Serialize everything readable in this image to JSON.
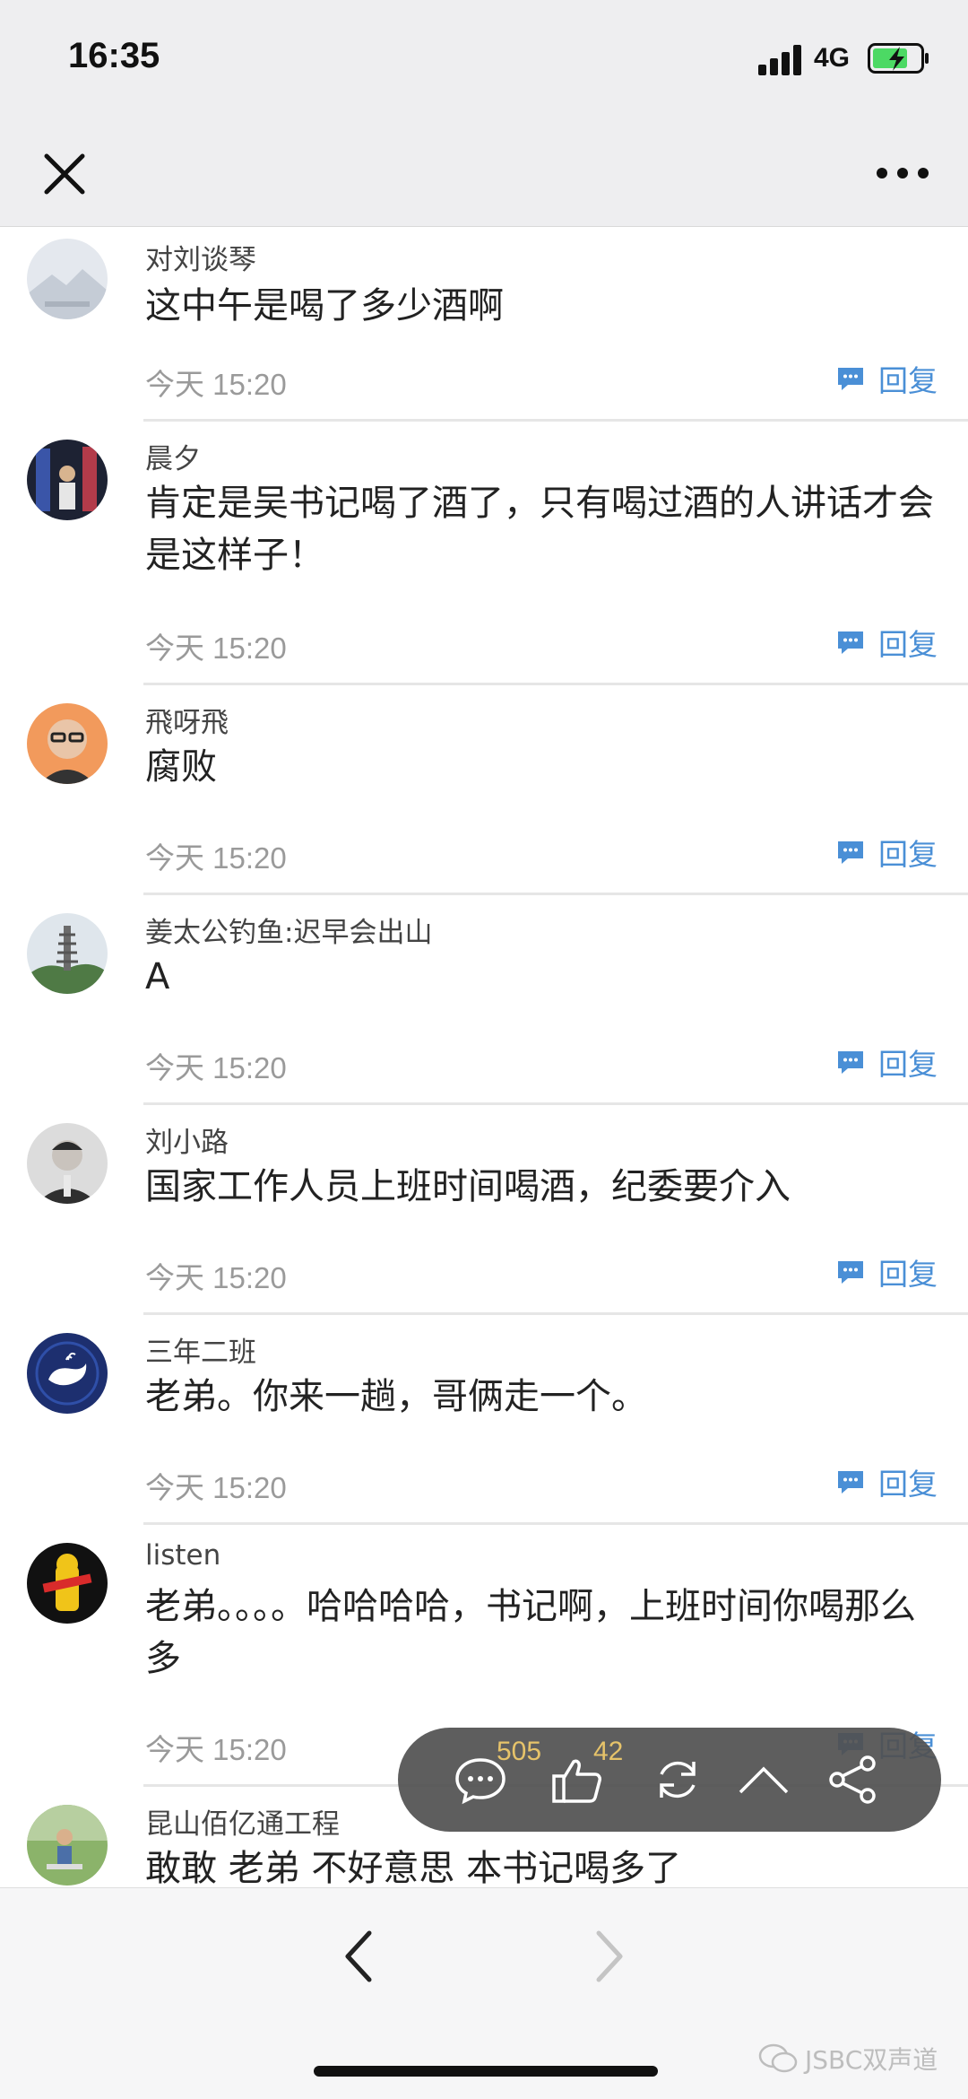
{
  "status_bar": {
    "time": "16:35",
    "network": "4G"
  },
  "comments": [
    {
      "name": "对刘谈琴",
      "text": "这中午是喝了多少酒啊",
      "time": "今天 15:20",
      "reply_label": "回复",
      "avatar": "landscape-avatar"
    },
    {
      "name": "晨夕",
      "text": "肯定是吴书记喝了酒了，只有喝过酒的人讲话才会是这样子！",
      "time": "今天 15:20",
      "reply_label": "回复",
      "avatar": "stage-avatar"
    },
    {
      "name": "飛呀飛",
      "text": "腐败",
      "time": "今天 15:20",
      "reply_label": "回复",
      "avatar": "glasses-person-avatar"
    },
    {
      "name": "姜太公钓鱼:迟早会出山",
      "text": "A",
      "time": "今天 15:20",
      "reply_label": "回复",
      "avatar": "pagoda-avatar"
    },
    {
      "name": "刘小路",
      "text": "国家工作人员上班时间喝酒，纪委要介入",
      "time": "今天 15:20",
      "reply_label": "回复",
      "avatar": "officer-avatar"
    },
    {
      "name": "三年二班",
      "text": "老弟。你来一趟，哥俩走一个。",
      "time": "今天 15:20",
      "reply_label": "回复",
      "avatar": "whale-avatar"
    },
    {
      "name": "listen",
      "text": "老弟。。。。哈哈哈哈，书记啊，上班时间你喝那么多",
      "time": "今天 15:20",
      "reply_label": "回复",
      "avatar": "hydrant-avatar"
    },
    {
      "name": "昆山佰亿通工程",
      "text": "敢敢 老弟 不好意思 本书记喝多了",
      "time": "",
      "reply_label": "",
      "avatar": "outdoor-person-avatar"
    }
  ],
  "action_bar": {
    "comment_count": "505",
    "like_count": "42"
  },
  "watermark": "JSBC双声道",
  "colors": {
    "accent": "#4a8fd6",
    "counter": "#e6c36a",
    "bar_bg": "#505050"
  }
}
